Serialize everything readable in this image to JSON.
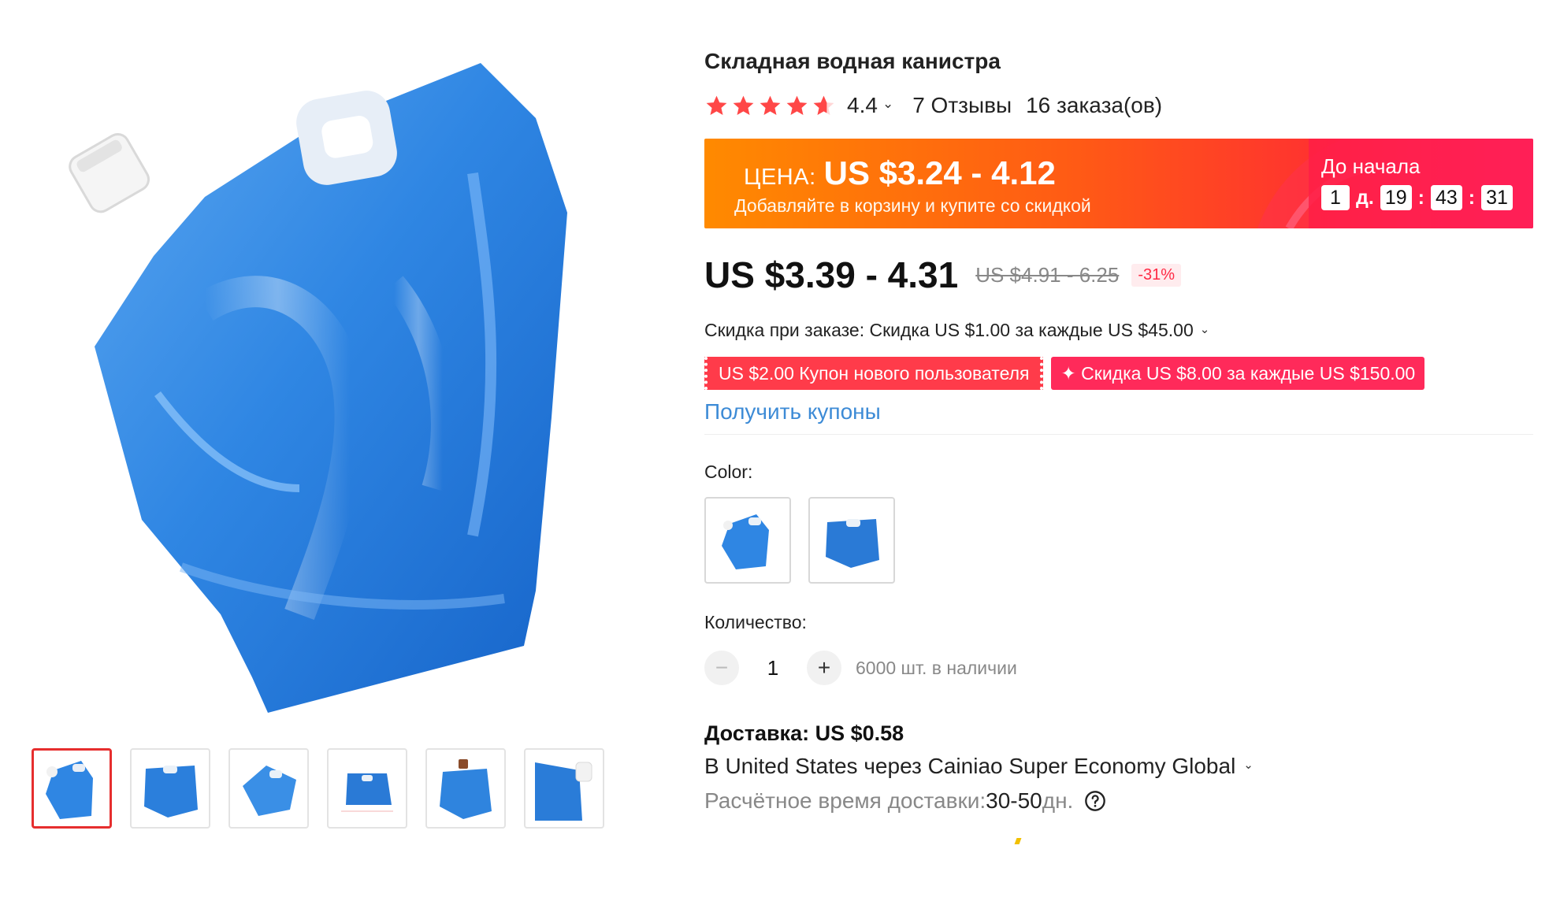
{
  "product": {
    "title": "Складная водная канистра",
    "rating": "4.4",
    "reviews": "7 Отзывы",
    "orders": "16 заказа(ов)",
    "star_color": "#ff4747"
  },
  "promo": {
    "label": "ЦЕНА:",
    "price": "US $3.24 - 4.12",
    "subtitle": "Добавляйте в корзину и купите со скидкой",
    "countdown_title": "До начала",
    "days": "1",
    "days_unit": "д.",
    "hours": "19",
    "minutes": "43",
    "seconds": "31",
    "sep": ":",
    "gradient_start": "#ff8a00",
    "gradient_end": "#ff2750"
  },
  "price": {
    "current": "US $3.39 - 4.31",
    "original": "US $4.91 - 6.25",
    "discount": "-31%"
  },
  "bulk": {
    "text": "Скидка при заказе: Скидка US $1.00 за каждые US $45.00"
  },
  "coupons": {
    "new_user": "US $2.00 Купон нового пользователя",
    "store": "✦ Скидка US $8.00 за каждые US $150.00",
    "get_link": "Получить купоны"
  },
  "color": {
    "label": "Color:"
  },
  "quantity": {
    "label": "Количество:",
    "minus": "−",
    "plus": "+",
    "value": "1",
    "stock": "6000 шт. в наличии"
  },
  "shipping": {
    "title": "Доставка: US $0.58",
    "via": "В United States через Cainiao Super Economy Global",
    "time_label": "Расчётное время доставки: ",
    "time_value": "30-50",
    "time_unit": "дн."
  },
  "icons": {
    "chevron": "⌄",
    "help": "help-circle-icon"
  },
  "gallery": {
    "thumb_count": 6,
    "active_index": 0,
    "accent": "#e62e2e"
  }
}
